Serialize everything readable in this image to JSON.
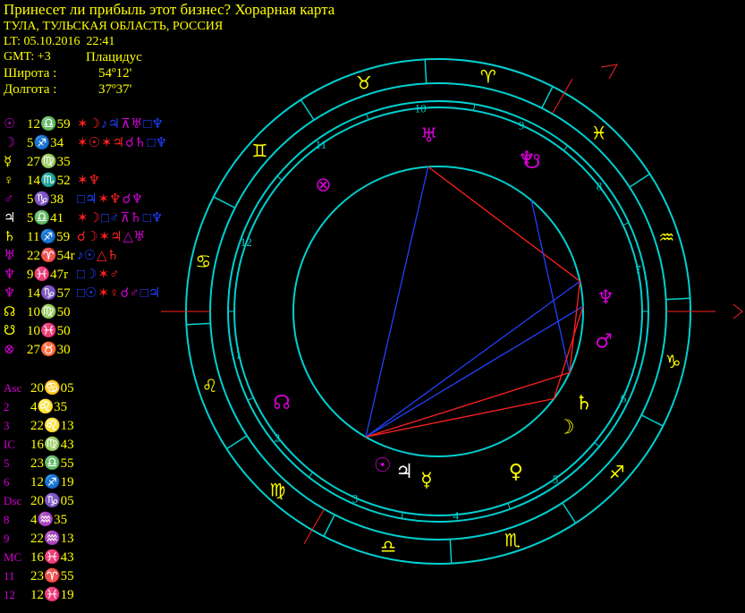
{
  "header": {
    "title": "Принесет ли прибыль этот бизнес? Хорарная карта",
    "place": "ТУЛА, ТУЛЬСКАЯ ОБЛАСТЬ, РОССИЯ",
    "lt": "LT: 05.10.2016  22:41",
    "gmt": "GMT: +3",
    "house_system": "Плацидус",
    "latitude_label": "Широта :",
    "latitude_value": "54º12'",
    "longitude_label": "Долгота :",
    "longitude_value": "37º37'"
  },
  "colors": {
    "yellow": "#ffff00",
    "cyan": "#00d0d0",
    "magenta": "#d200d2",
    "red": "#ff2020",
    "blue": "#2040ff",
    "white": "#ffffff"
  },
  "planets": [
    {
      "glyph": "☉",
      "color": "#d200d2",
      "position": "12♎59",
      "aspects": [
        {
          "t": "✶☽",
          "c": "#ff2020"
        },
        {
          "t": "♪♃",
          "c": "#2040ff"
        },
        {
          "t": "⊼♅",
          "c": "#d200d2"
        },
        {
          "t": "□♆",
          "c": "#2040ff"
        }
      ]
    },
    {
      "glyph": "☽",
      "color": "#d200d2",
      "position": "5♐34",
      "aspects": [
        {
          "t": "✶☉",
          "c": "#ff2020"
        },
        {
          "t": "✶♃",
          "c": "#ff2020"
        },
        {
          "t": "☌♄",
          "c": "#d200d2"
        },
        {
          "t": "□♆",
          "c": "#2040ff"
        }
      ]
    },
    {
      "glyph": "☿",
      "color": "#ffff00",
      "position": "27♍35",
      "aspects": []
    },
    {
      "glyph": "♀",
      "color": "#ffff00",
      "position": "14♏52",
      "aspects": [
        {
          "t": "✶♆",
          "c": "#ff2020"
        }
      ]
    },
    {
      "glyph": "♂",
      "color": "#d200d2",
      "position": "5♑38",
      "aspects": [
        {
          "t": "□♃",
          "c": "#2040ff"
        },
        {
          "t": "✶♆",
          "c": "#ff2020"
        },
        {
          "t": "☌♆",
          "c": "#d200d2"
        }
      ]
    },
    {
      "glyph": "♃",
      "color": "#ffffff",
      "position": "5♎41",
      "aspects": [
        {
          "t": "✶☽",
          "c": "#ff2020"
        },
        {
          "t": "□♂",
          "c": "#2040ff"
        },
        {
          "t": "⊼♄",
          "c": "#d200d2"
        },
        {
          "t": "□♆",
          "c": "#2040ff"
        }
      ]
    },
    {
      "glyph": "♄",
      "color": "#ffff00",
      "position": "11♐59",
      "aspects": [
        {
          "t": "☌☽",
          "c": "#ff2020"
        },
        {
          "t": "✶♃",
          "c": "#ff2020"
        },
        {
          "t": "△♅",
          "c": "#d200d2"
        }
      ]
    },
    {
      "glyph": "♅",
      "color": "#d200d2",
      "position": "22♈54r",
      "aspects": [
        {
          "t": "♪☉",
          "c": "#2040ff"
        },
        {
          "t": "△♄",
          "c": "#ff2020"
        }
      ]
    },
    {
      "glyph": "♆",
      "color": "#d200d2",
      "position": "9♓47r",
      "aspects": [
        {
          "t": "□☽",
          "c": "#2040ff"
        },
        {
          "t": "✶♂",
          "c": "#ff2020"
        }
      ]
    },
    {
      "glyph": "♆",
      "color": "#d200d2",
      "position": "14♑57",
      "aspects": [
        {
          "t": "□☉",
          "c": "#2040ff"
        },
        {
          "t": "✶♀",
          "c": "#ff2020"
        },
        {
          "t": "☌♂",
          "c": "#d200d2"
        },
        {
          "t": "□♃",
          "c": "#2040ff"
        }
      ]
    },
    {
      "glyph": "☊",
      "color": "#ffff00",
      "position": "10♍50",
      "aspects": []
    },
    {
      "glyph": "☋",
      "color": "#ffff00",
      "position": "10♓50",
      "aspects": []
    },
    {
      "glyph": "⊗",
      "color": "#d200d2",
      "position": "27♉30",
      "aspects": []
    }
  ],
  "cusps": [
    {
      "label": "Asc",
      "value": "20♋05"
    },
    {
      "label": "2",
      "value": "4♌35"
    },
    {
      "label": "3",
      "value": "22♌13"
    },
    {
      "label": "IC",
      "value": "16♍43"
    },
    {
      "label": "5",
      "value": "23♎55"
    },
    {
      "label": "6",
      "value": "12♐19"
    },
    {
      "label": "Dsc",
      "value": "20♑05"
    },
    {
      "label": "8",
      "value": "4♒35"
    },
    {
      "label": "9",
      "value": "22♒13"
    },
    {
      "label": "MC",
      "value": "16♓43"
    },
    {
      "label": "11",
      "value": "23♈55"
    },
    {
      "label": "12",
      "value": "12♓19"
    }
  ],
  "wheel": {
    "sign_glyphs": [
      {
        "sign": "aries",
        "glyph": "♈"
      },
      {
        "sign": "pisces",
        "glyph": "♓"
      },
      {
        "sign": "aquarius",
        "glyph": "♒"
      },
      {
        "sign": "capricorn",
        "glyph": "♑"
      },
      {
        "sign": "sagittarius",
        "glyph": "♐"
      },
      {
        "sign": "scorpio",
        "glyph": "♏"
      },
      {
        "sign": "libra",
        "glyph": "♎"
      },
      {
        "sign": "virgo",
        "glyph": "♍"
      },
      {
        "sign": "leo",
        "glyph": "♌"
      },
      {
        "sign": "cancer",
        "glyph": "♋"
      },
      {
        "sign": "gemini",
        "glyph": "♊"
      },
      {
        "sign": "taurus",
        "glyph": "♉"
      }
    ],
    "house_numbers": [
      "1",
      "2",
      "3",
      "4",
      "5",
      "6",
      "7",
      "8",
      "9",
      "10",
      "11",
      "12"
    ],
    "planet_glyphs": [
      {
        "name": "uranus",
        "glyph": "♅",
        "color": "#d200d2"
      },
      {
        "name": "fortune",
        "glyph": "⊗",
        "color": "#d200d2"
      },
      {
        "name": "neptune",
        "glyph": "♆",
        "color": "#d200d2"
      },
      {
        "name": "south-node",
        "glyph": "☋",
        "color": "#d200d2"
      },
      {
        "name": "pluto",
        "glyph": "♆",
        "color": "#d200d2"
      },
      {
        "name": "mars",
        "glyph": "♂",
        "color": "#d200d2"
      },
      {
        "name": "saturn",
        "glyph": "♄",
        "color": "#ffff00"
      },
      {
        "name": "moon",
        "glyph": "☽",
        "color": "#ffff00"
      },
      {
        "name": "venus",
        "glyph": "♀",
        "color": "#ffff00"
      },
      {
        "name": "sun",
        "glyph": "☉",
        "color": "#d200d2"
      },
      {
        "name": "jupiter",
        "glyph": "♃",
        "color": "#ffffff"
      },
      {
        "name": "mercury",
        "glyph": "☿",
        "color": "#ffff00"
      },
      {
        "name": "north-node",
        "glyph": "☊",
        "color": "#d200d2"
      }
    ]
  }
}
